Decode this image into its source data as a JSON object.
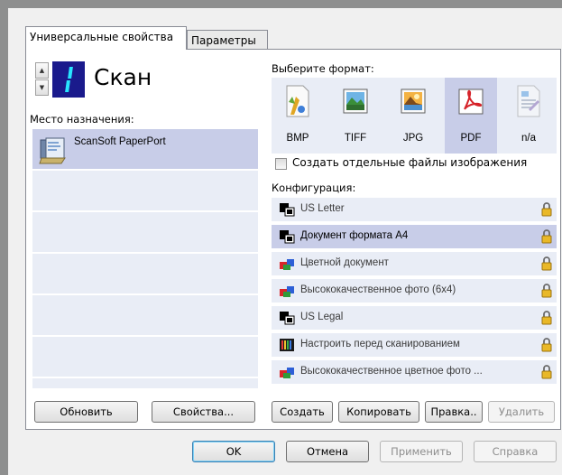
{
  "tabs": [
    {
      "label": "Универсальные свойства",
      "active": true
    },
    {
      "label": "Параметры",
      "active": false
    }
  ],
  "profile": {
    "number": "1",
    "name": "Скан"
  },
  "destination": {
    "label": "Место назначения:",
    "items": [
      {
        "label": "ScanSoft PaperPort",
        "icon": "paperport-icon",
        "selected": true
      }
    ],
    "buttons": {
      "refresh": "Обновить",
      "properties": "Свойства..."
    }
  },
  "format": {
    "label": "Выберите формат:",
    "items": [
      {
        "label": "BMP",
        "icon": "bmp-icon",
        "selected": false
      },
      {
        "label": "TIFF",
        "icon": "tiff-icon",
        "selected": false
      },
      {
        "label": "JPG",
        "icon": "jpg-icon",
        "selected": false
      },
      {
        "label": "PDF",
        "icon": "pdf-icon",
        "selected": true
      },
      {
        "label": "n/a",
        "icon": "text-document-icon",
        "selected": false
      }
    ],
    "separate_files_label": "Создать отдельные файлы изображения",
    "separate_files_checked": false
  },
  "configuration": {
    "label": "Конфигурация:",
    "items": [
      {
        "label": "US Letter",
        "icon": "black-white-icon",
        "selected": false
      },
      {
        "label": "Документ формата А4",
        "icon": "black-white-icon",
        "selected": true
      },
      {
        "label": "Цветной документ",
        "icon": "color-icon",
        "selected": false
      },
      {
        "label": "Высококачественное фото (6x4)",
        "icon": "color-icon",
        "selected": false
      },
      {
        "label": "US Legal",
        "icon": "black-white-icon",
        "selected": false
      },
      {
        "label": "Настроить перед сканированием",
        "icon": "configure-icon",
        "selected": false
      },
      {
        "label": "Высококачественное цветное фото ...",
        "icon": "color-icon",
        "selected": false
      }
    ],
    "buttons": {
      "create": "Создать",
      "copy": "Копировать",
      "edit": "Правка..",
      "delete": "Удалить"
    }
  },
  "dialog_buttons": {
    "ok": "OK",
    "cancel": "Отмена",
    "apply": "Применить",
    "help": "Справка"
  },
  "colors": {
    "selection": "#c8cde8",
    "list_background": "#e9edf6",
    "lcd_background": "#1a1a8c",
    "lcd_digit": "#28e5ff"
  }
}
